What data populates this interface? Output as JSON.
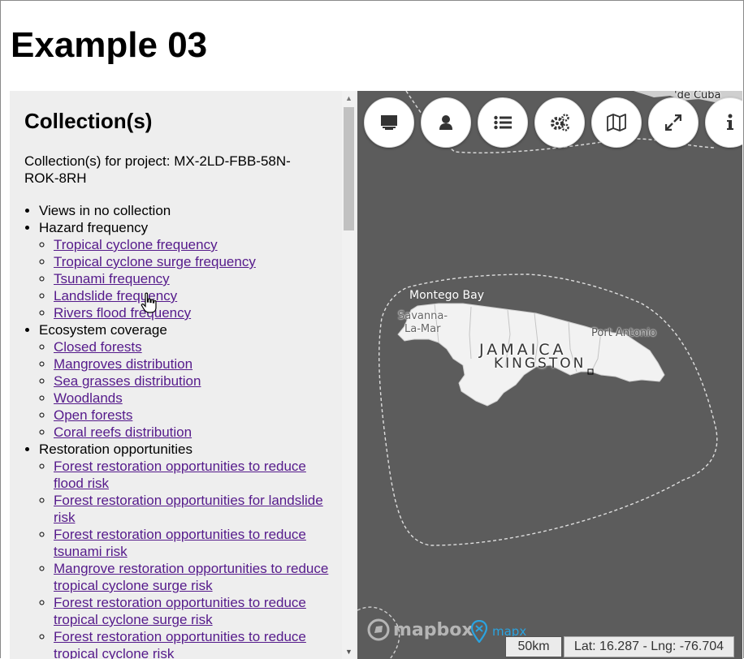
{
  "page": {
    "title": "Example 03"
  },
  "panel": {
    "title": "Collection(s)",
    "description": "Collection(s) for project: MX-2LD-FBB-58N-ROK-8RH"
  },
  "collections": [
    {
      "label": "Views in no collection",
      "items": []
    },
    {
      "label": "Hazard frequency",
      "items": [
        "Tropical cyclone frequency",
        "Tropical cyclone surge frequency",
        "Tsunami frequency",
        "Landslide frequency",
        "Rivers flood frequency"
      ]
    },
    {
      "label": "Ecosystem coverage",
      "items": [
        "Closed forests",
        "Mangroves distribution",
        "Sea grasses distribution",
        "Woodlands",
        "Open forests",
        "Coral reefs distribution"
      ]
    },
    {
      "label": "Restoration opportunities",
      "items": [
        "Forest restoration opportunities to reduce flood risk",
        "Forest restoration opportunities for landslide risk",
        "Forest restoration opportunities to reduce tsunami risk",
        "Mangrove restoration opportunities to reduce tropical cyclone surge risk",
        "Forest restoration opportunities to reduce tropical cyclone surge risk",
        "Forest restoration opportunities to reduce tropical cyclone risk"
      ]
    }
  ],
  "map": {
    "toolbar": [
      {
        "name": "desktop-icon"
      },
      {
        "name": "user-icon"
      },
      {
        "name": "list-icon"
      },
      {
        "name": "gears-icon"
      },
      {
        "name": "map-icon"
      },
      {
        "name": "expand-icon"
      },
      {
        "name": "info-icon"
      }
    ],
    "labels": {
      "cuba": "'de Cuba",
      "montego_bay": "Montego Bay",
      "savanna_la_mar_1": "Savanna-",
      "savanna_la_mar_2": "La-Mar",
      "port_antonio": "Port Antonio",
      "jamaica": "JAMAICA",
      "kingston": "KINGSTON"
    },
    "attribution": {
      "mapbox": "mapbox",
      "mapx": "mapx"
    },
    "scale": "50km",
    "coordinates": "Lat: 16.287 - Lng: -76.704",
    "colors": {
      "water": "#5c5c5c",
      "land": "#f2f2f2",
      "link": "#551a8b",
      "mapx": "#2aa3e0"
    }
  }
}
